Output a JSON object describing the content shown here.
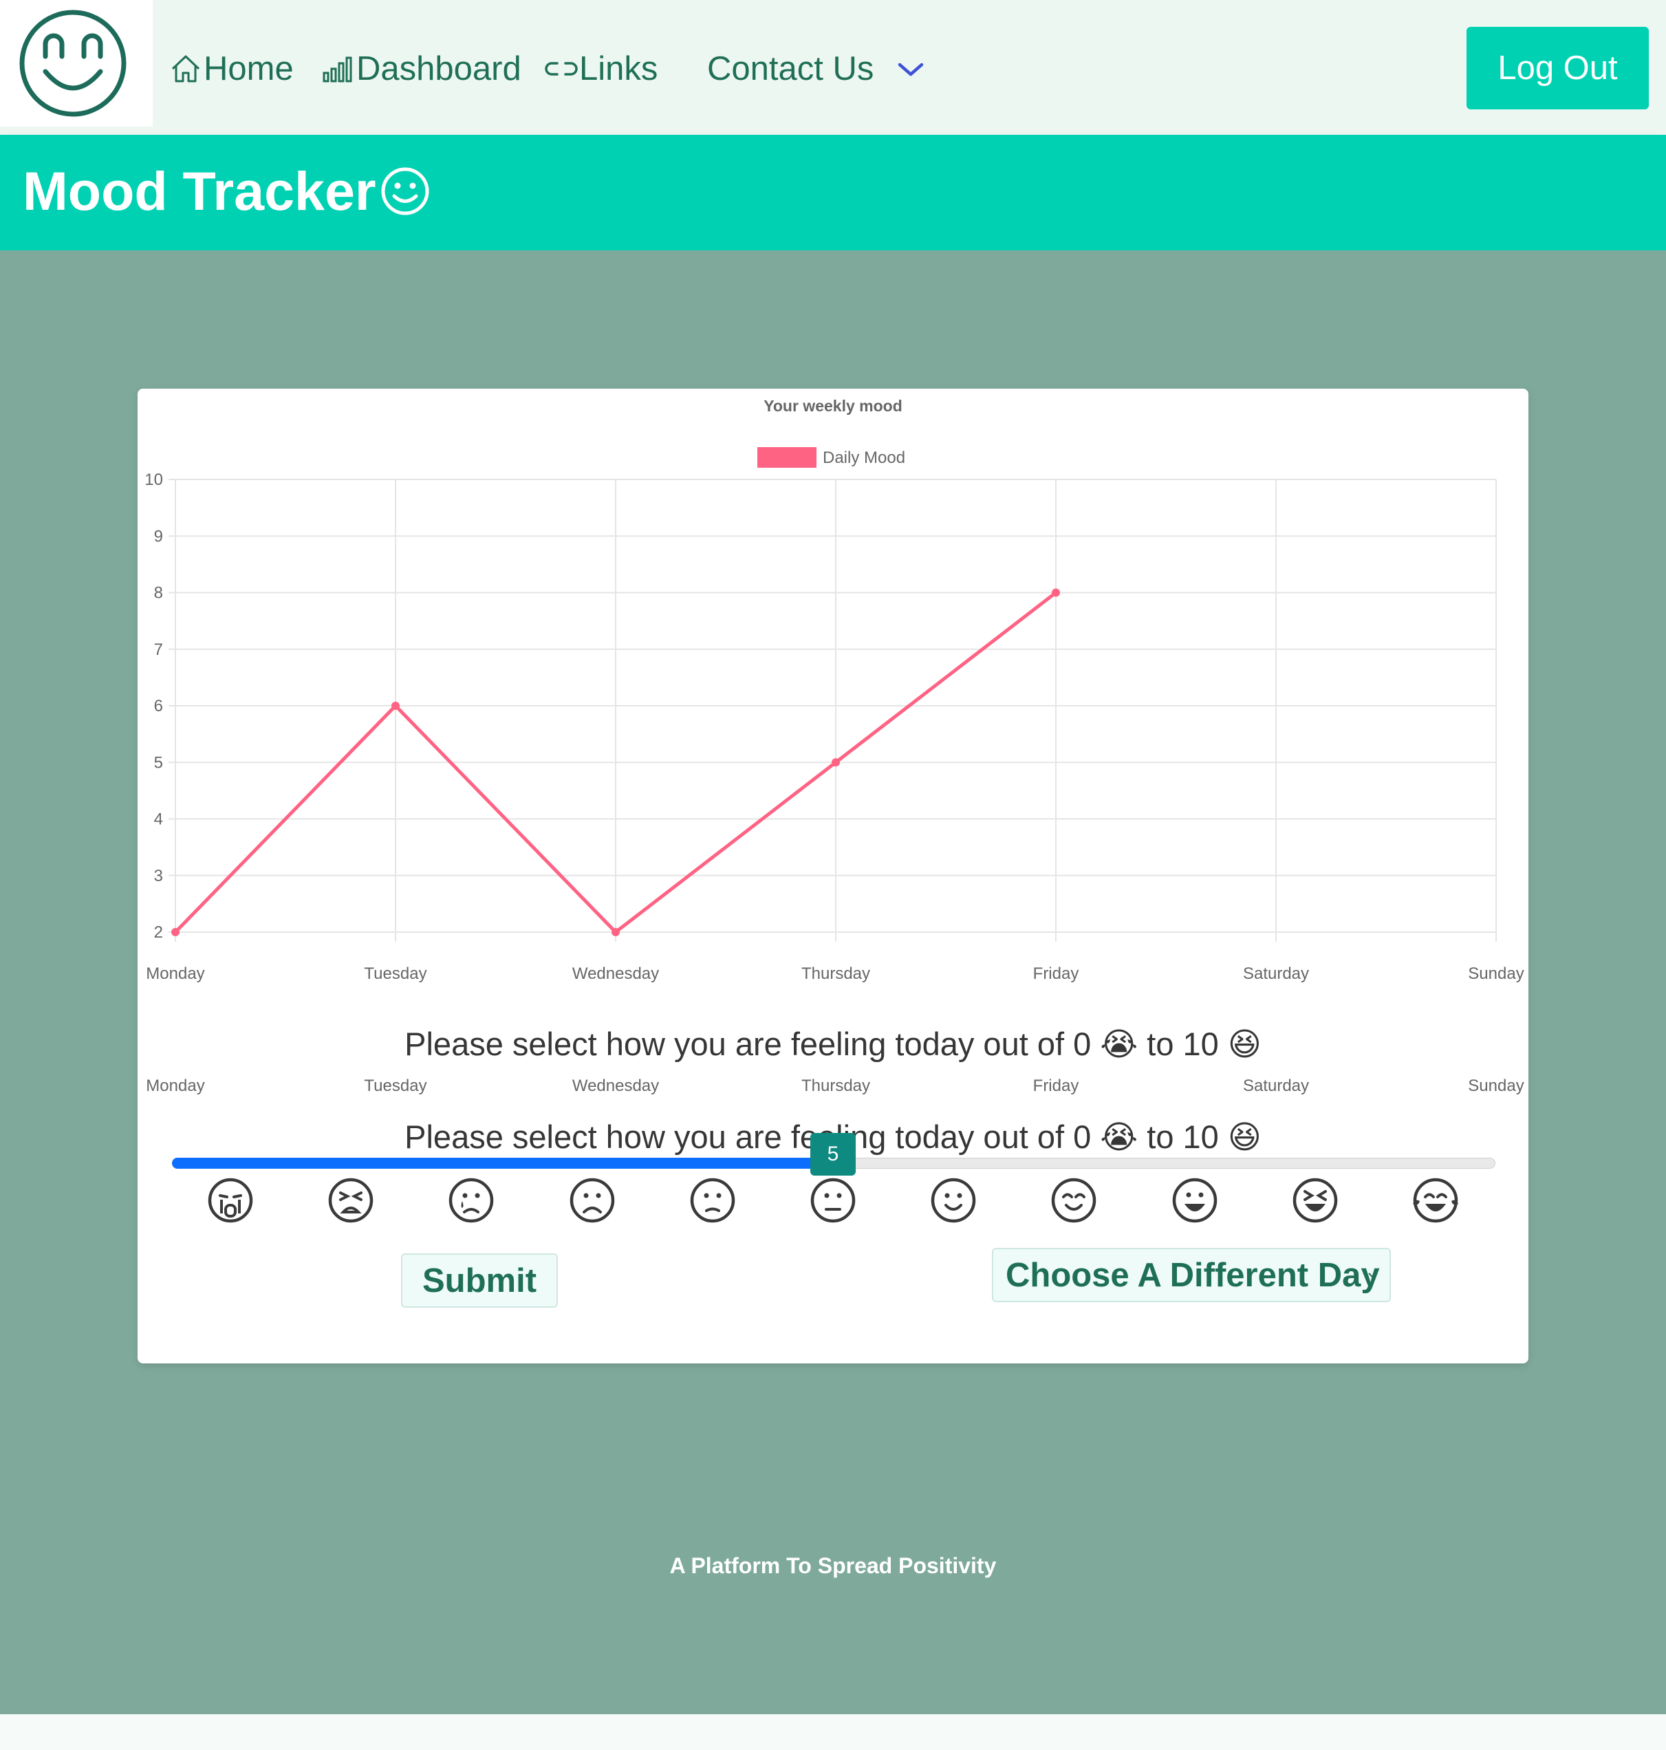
{
  "nav": {
    "logo": "smiley-logo",
    "items": [
      {
        "label": "Home",
        "icon": "home-icon"
      },
      {
        "label": "Dashboard",
        "icon": "bar-chart-icon"
      },
      {
        "label": "Links",
        "icon": "link-icon"
      },
      {
        "label": "Contact Us",
        "icon": "chevron-down-icon"
      }
    ],
    "logout_label": "Log Out"
  },
  "hero": {
    "title": "Mood Tracker",
    "icon": "smiley-icon"
  },
  "chart_data": {
    "type": "line",
    "title": "Your weekly mood",
    "categories": [
      "Monday",
      "Tuesday",
      "Wednesday",
      "Thursday",
      "Friday",
      "Saturday",
      "Sunday"
    ],
    "series": [
      {
        "name": "Daily Mood",
        "values": [
          2,
          6,
          2,
          5,
          8,
          null,
          null
        ],
        "color": "#ff6384"
      }
    ],
    "ylim": [
      2,
      10
    ],
    "yticks": [
      2,
      3,
      4,
      5,
      6,
      7,
      8,
      9,
      10
    ],
    "grid": true,
    "legend": "top-center"
  },
  "mood_form": {
    "prompt": "Please select how you are feeling today out of 0 😭 to 10 😆",
    "slider_min": 0,
    "slider_max": 10,
    "slider_value": "5",
    "emojis": [
      "crying-face-icon",
      "tired-face-icon",
      "sad-tear-face-icon",
      "frowning-face-icon",
      "slightly-frowning-face-icon",
      "neutral-face-icon",
      "smiling-face-icon",
      "smiling-eyes-face-icon",
      "grinning-face-icon",
      "squinting-laughing-face-icon",
      "tears-of-joy-face-icon"
    ],
    "submit_label": "Submit",
    "day_select_value": "Choose A Different Day"
  },
  "colors": {
    "accent": "#00d1b2",
    "nav_text": "#1f6f56",
    "background": "#7faa9b",
    "line": "#ff6384",
    "slider_fill": "#0d6efd",
    "slider_thumb": "#0e8a80"
  },
  "footer": {
    "tagline": "A Platform To Spread Positivity"
  }
}
